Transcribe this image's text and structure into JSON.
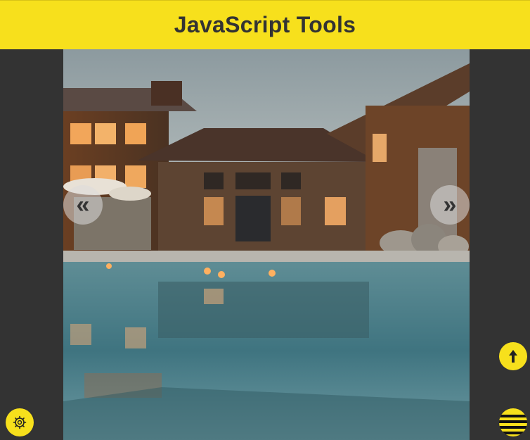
{
  "header": {
    "title": "JavaScript Tools"
  },
  "carousel": {
    "prev_label": "«",
    "next_label": "»",
    "image": "photo of modern wooden house with swimming pool at dusk"
  },
  "controls": {
    "scroll_top_label": "🠕",
    "settings_icon": "gear-icon",
    "menu_icon": "hamburger-icon"
  },
  "colors": {
    "accent": "#f7e01c",
    "background": "#333333",
    "text": "#333333"
  }
}
